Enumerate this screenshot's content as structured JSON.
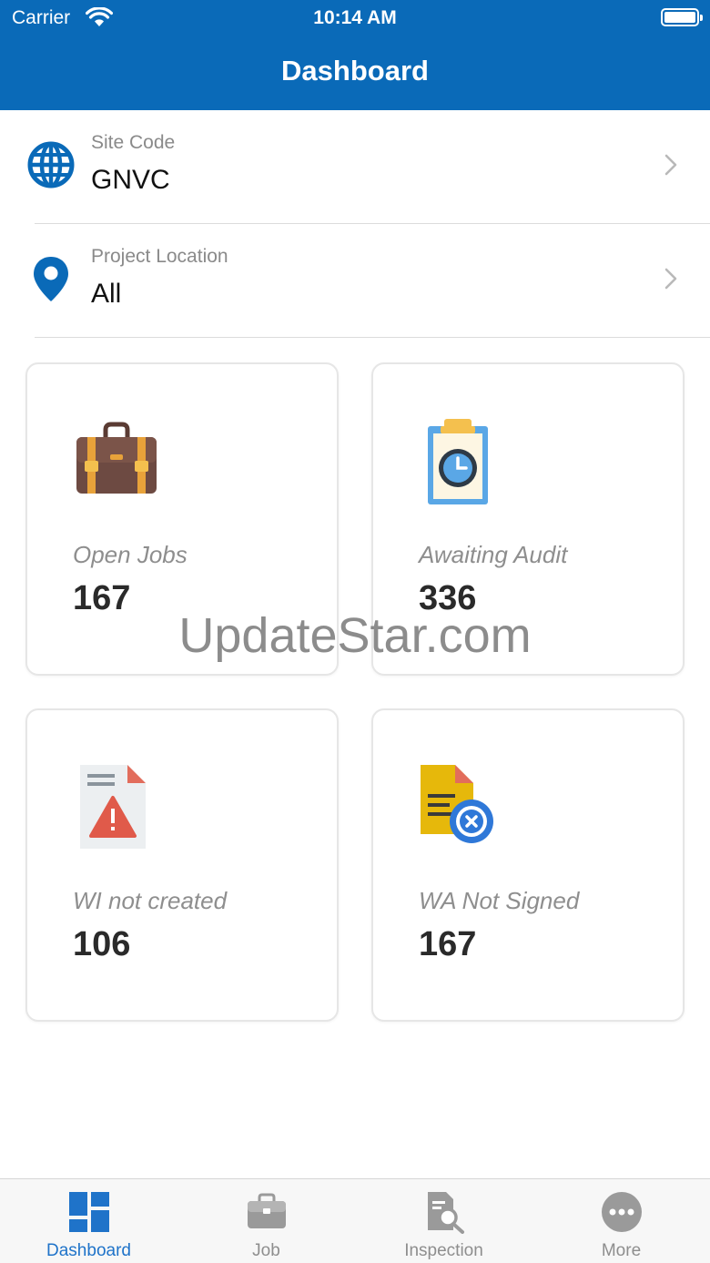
{
  "status_bar": {
    "carrier": "Carrier",
    "time": "10:14 AM"
  },
  "header": {
    "title": "Dashboard"
  },
  "site_code": {
    "label": "Site Code",
    "value": "GNVC",
    "icon": "globe-icon"
  },
  "project_location": {
    "label": "Project Location",
    "value": "All",
    "icon": "location-pin-icon"
  },
  "cards": [
    {
      "label": "Open Jobs",
      "value": "167",
      "icon": "briefcase-icon"
    },
    {
      "label": "Awaiting Audit",
      "value": "336",
      "icon": "clipboard-clock-icon"
    },
    {
      "label": "WI not created",
      "value": "106",
      "icon": "document-warning-icon"
    },
    {
      "label": "WA Not Signed",
      "value": "167",
      "icon": "document-cancel-icon"
    }
  ],
  "watermark": "UpdateStar.com",
  "tabbar": {
    "tabs": [
      {
        "label": "Dashboard",
        "icon": "dashboard-grid-icon",
        "active": true
      },
      {
        "label": "Job",
        "icon": "briefcase-icon",
        "active": false
      },
      {
        "label": "Inspection",
        "icon": "inspection-icon",
        "active": false
      },
      {
        "label": "More",
        "icon": "more-dots-icon",
        "active": false
      }
    ]
  },
  "colors": {
    "primary": "#0a6ab8",
    "tab_active": "#1f73c9",
    "tab_inactive": "#8e8e8e"
  }
}
